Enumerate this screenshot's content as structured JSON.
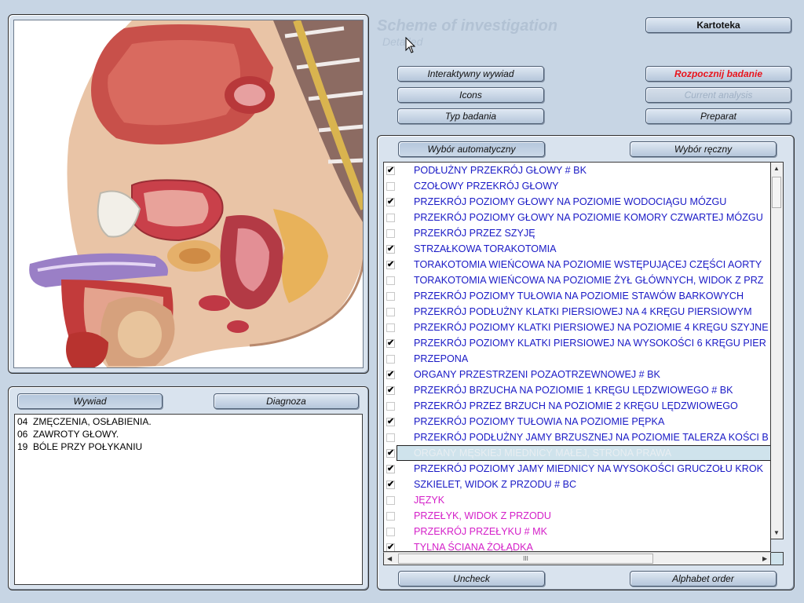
{
  "header": {
    "title": "Scheme of investigation",
    "subtitle": "Detailed"
  },
  "top_buttons": {
    "kartoteka": "Kartoteka",
    "wywiad_interaktywny": "Interaktywny wywiad",
    "icons": "Icons",
    "typ_badania": "Typ badania",
    "rozpocznij": "Rozpocznij badanie",
    "current_analysis": "Current analysis",
    "preparat": "Preparat"
  },
  "left_panel": {
    "tab_wywiad": "Wywiad",
    "tab_diagnoza": "Diagnoza",
    "symptoms": [
      {
        "code": "04",
        "text": "ZMĘCZENIA, OSŁABIENIA."
      },
      {
        "code": "06",
        "text": "ZAWROTY GŁOWY."
      },
      {
        "code": "19",
        "text": "BÓLE PRZY POŁYKANIU"
      }
    ]
  },
  "right_panel": {
    "btn_auto": "Wybór automatyczny",
    "btn_manual": "Wybór ręczny",
    "btn_uncheck": "Uncheck",
    "btn_alphabet": "Alphabet order",
    "items": [
      {
        "label": "PODŁUŻNY PRZEKRÓJ GŁOWY # BK",
        "checked": true,
        "color": "blue"
      },
      {
        "label": "CZOŁOWY PRZEKRÓJ GŁOWY",
        "checked": false,
        "color": "blue"
      },
      {
        "label": "PRZEKRÓJ POZIOMY GŁOWY NA POZIOMIE WODOCIĄGU MÓZGU",
        "checked": true,
        "color": "blue"
      },
      {
        "label": "PRZEKRÓJ POZIOMY GŁOWY NA POZIOMIE KOMORY CZWARTEJ MÓZGU",
        "checked": false,
        "color": "blue"
      },
      {
        "label": "PRZEKRÓJ PRZEZ SZYJĘ",
        "checked": false,
        "color": "blue"
      },
      {
        "label": "STRZAŁKOWA TORAKOTOMIA",
        "checked": true,
        "color": "blue"
      },
      {
        "label": "TORAKOTOMIA WIEŃCOWA NA POZIOMIE  WSTĘPUJĄCEJ CZĘŚCI AORTY",
        "checked": true,
        "color": "blue"
      },
      {
        "label": "TORAKOTOMIA WIEŃCOWA NA POZIOMIE ŻYŁ GŁÓWNYCH, WIDOK Z PRZ",
        "checked": false,
        "color": "blue"
      },
      {
        "label": "PRZEKRÓJ POZIOMY TUŁOWIA NA POZIOMIE STAWÓW BARKOWYCH",
        "checked": false,
        "color": "blue"
      },
      {
        "label": "PRZEKRÓJ PODŁUŻNY KLATKI PIERSIOWEJ NA 4 KRĘGU PIERSIOWYM",
        "checked": false,
        "color": "blue"
      },
      {
        "label": "PRZEKRÓJ POZIOMY KLATKI PIERSIOWEJ NA POZIOMIE 4 KRĘGU SZYJNE",
        "checked": false,
        "color": "blue"
      },
      {
        "label": "PRZEKRÓJ POZIOMY KLATKI PIERSIOWEJ NA WYSOKOŚCI 6 KRĘGU PIER",
        "checked": true,
        "color": "blue"
      },
      {
        "label": "PRZEPONA",
        "checked": false,
        "color": "blue"
      },
      {
        "label": "ORGANY PRZESTRZENI POZAOTRZEWNOWEJ # BK",
        "checked": true,
        "color": "blue"
      },
      {
        "label": "PRZEKRÓJ BRZUCHA NA POZIOMIE 1 KRĘGU LĘDZWIOWEGO # BK",
        "checked": true,
        "color": "blue"
      },
      {
        "label": "PRZEKRÓJ PRZEZ BRZUCH NA POZIOMIE 2 KRĘGU LĘDZWIOWEGO",
        "checked": false,
        "color": "blue"
      },
      {
        "label": "PRZEKRÓJ POZIOMY TUŁOWIA NA POZIOMIE PĘPKA",
        "checked": true,
        "color": "blue"
      },
      {
        "label": "PRZEKRÓJ PODŁUŻNY JAMY BRZUSZNEJ NA POZIOMIE TALERZA KOŚCI B",
        "checked": false,
        "color": "blue"
      },
      {
        "label": "ORGANY MĘSKIEJ MIEDNICY MAŁEJ, STRONA PRAWA",
        "checked": true,
        "color": "selected",
        "selected": true
      },
      {
        "label": "PRZEKRÓJ POZIOMY JAMY MIEDNICY NA WYSOKOŚCI GRUCZOŁU KROK",
        "checked": true,
        "color": "blue"
      },
      {
        "label": "SZKIELET, WIDOK Z PRZODU # BC",
        "checked": true,
        "color": "blue"
      },
      {
        "label": "JĘZYK",
        "checked": false,
        "color": "magenta"
      },
      {
        "label": "PRZEŁYK, WIDOK Z PRZODU",
        "checked": false,
        "color": "magenta"
      },
      {
        "label": "PRZEKRÓJ PRZEŁYKU # MK",
        "checked": false,
        "color": "magenta"
      },
      {
        "label": "TYLNA ŚCIANA ŻOŁĄDKA",
        "checked": true,
        "color": "magenta"
      }
    ]
  },
  "icons": {
    "scroll_up": "▲",
    "scroll_down": "▼",
    "scroll_left": "◀",
    "scroll_right": "▶",
    "checkmark": "✔",
    "thumb_grip": "III"
  }
}
